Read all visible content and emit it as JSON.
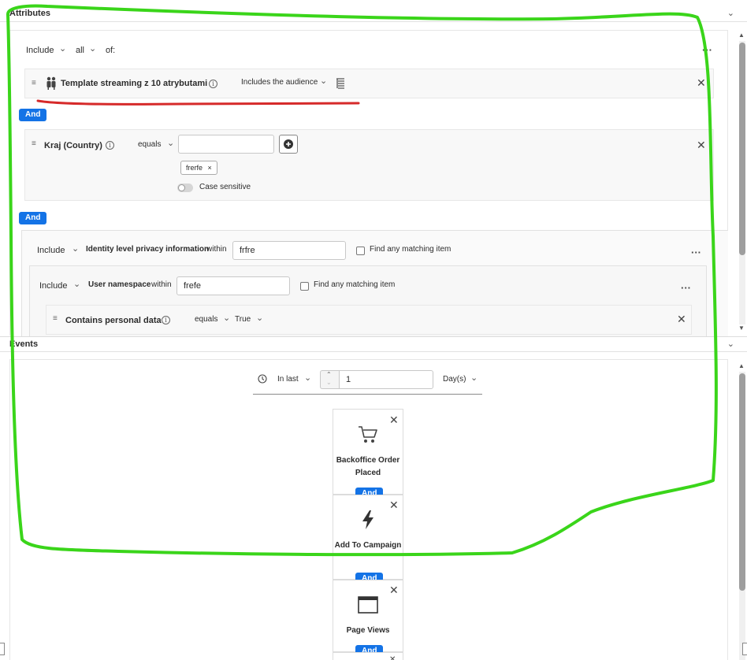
{
  "attributes": {
    "section_title": "Attributes",
    "include_label": "Include",
    "match_mode": "all",
    "of_label": "of:",
    "rules": [
      {
        "title": "Template streaming z 10 atrybutami",
        "operator": "Includes the audience"
      },
      {
        "title": "Kraj (Country)",
        "operator": "equals",
        "tag": "frerfe",
        "case_label": "Case sensitive"
      }
    ],
    "and_label": "And",
    "nested": {
      "include_label": "Include",
      "title": "Identity level privacy information",
      "within_label": "within",
      "within_value": "frfre",
      "find_label": "Find any matching item",
      "inner": {
        "include_label": "Include",
        "title": "User namespace",
        "within_label": "within",
        "within_value": "frefe",
        "find_label": "Find any matching item",
        "rule": {
          "title": "Contains personal data",
          "operator": "equals",
          "value": "True"
        }
      }
    }
  },
  "events": {
    "section_title": "Events",
    "time_mode": "In last",
    "time_value": "1",
    "time_unit": "Day(s)",
    "and_label": "And",
    "cards": [
      {
        "label": "Backoffice Order Placed",
        "icon": "cart-icon"
      },
      {
        "label": "Add To Campaign",
        "icon": "lightning-icon"
      },
      {
        "label": "Page Views",
        "icon": "browser-window-icon"
      }
    ]
  },
  "colors": {
    "accent": "#1473e6",
    "annotation_green": "#3ad51a",
    "annotation_red": "#d62a2a"
  }
}
